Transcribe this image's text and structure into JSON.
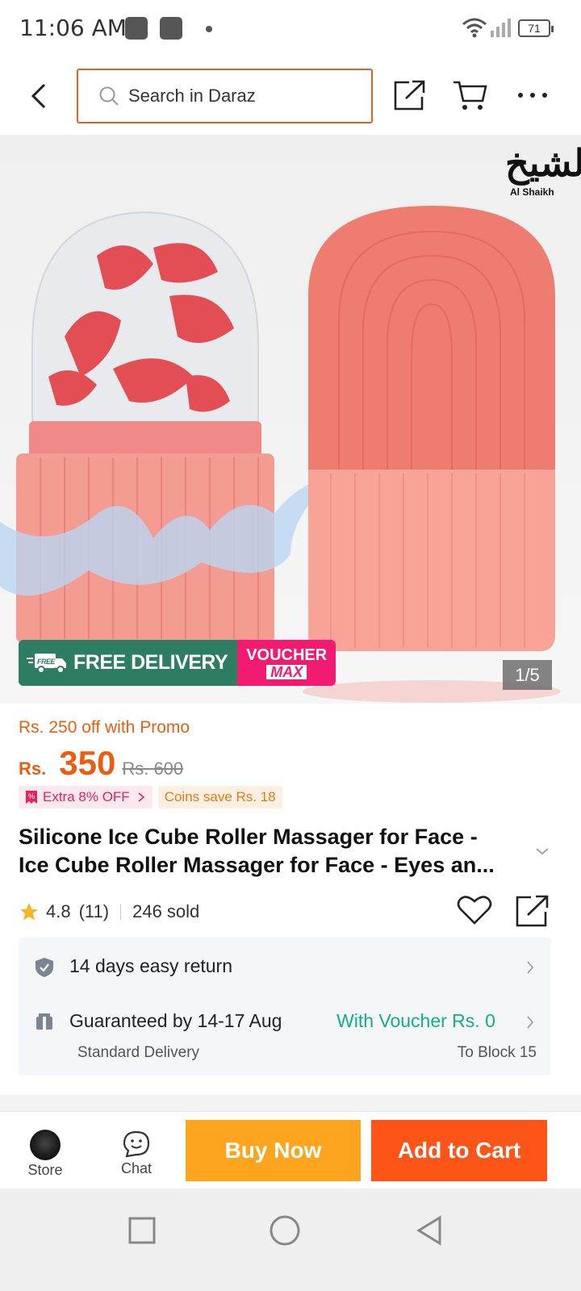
{
  "status_bar": {
    "time": "11:06 AM",
    "battery": "71"
  },
  "header": {
    "search_placeholder": "Search in Daraz",
    "icons": [
      "back-icon",
      "search-icon",
      "share-icon",
      "cart-icon",
      "more-icon"
    ]
  },
  "gallery": {
    "brand_logo_arabic": "الشيخ",
    "brand_logo_latin": "Al Shaikh",
    "badge_free": "FREE",
    "badge_delivery": "FREE DELIVERY",
    "badge_voucher_line1": "VOUCHER",
    "badge_voucher_line2": "MAX",
    "counter": "1/5"
  },
  "pricing": {
    "promo": "Rs. 250 off with Promo",
    "currency": "Rs.",
    "price": "350",
    "original_price": "Rs. 600",
    "extra_off": "Extra 8% OFF",
    "coins": "Coins save Rs. 18"
  },
  "product": {
    "title_line1": "Silicone Ice Cube Roller Massager for Face -",
    "title_line2": "Ice Cube Roller Massager for Face - Eyes an...",
    "rating": "4.8",
    "reviews": "(11)",
    "sold": "246 sold"
  },
  "service": {
    "return_text": "14 days easy return",
    "delivery_text": "Guaranteed by 14-17 Aug",
    "voucher_text": "With Voucher Rs. 0",
    "delivery_type": "Standard Delivery",
    "delivery_location": "To Block 15"
  },
  "actions": {
    "store": "Store",
    "chat": "Chat",
    "buy_now": "Buy Now",
    "add_to_cart": "Add to Cart"
  },
  "colors": {
    "accent_orange": "#fd5418",
    "buy_now_yellow": "#fea51f",
    "promo_text": "#ea5e13",
    "voucher_green": "#12b07e",
    "delivery_badge": "#2d7d63",
    "voucher_pink": "#f11c72"
  }
}
